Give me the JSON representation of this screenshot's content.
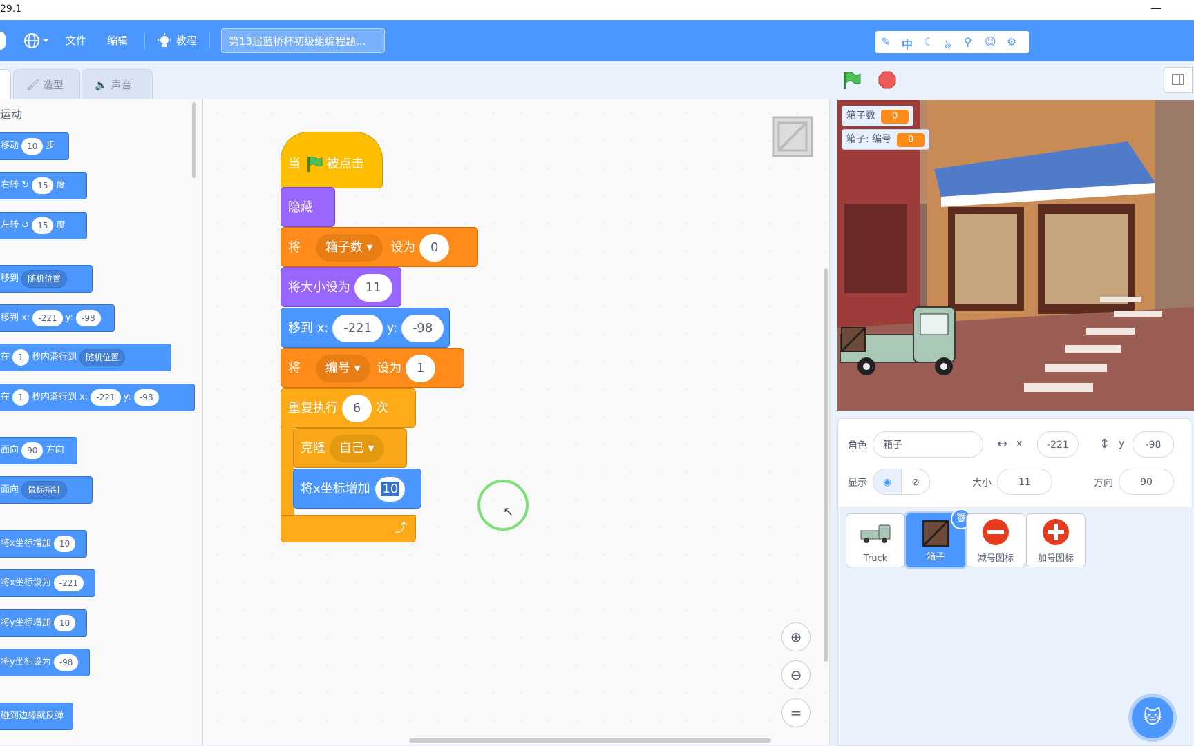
{
  "window": {
    "title": "29.1",
    "min": "—",
    "close": "—"
  },
  "menubar": {
    "file": "文件",
    "edit": "编辑",
    "tutorials": "教程",
    "project_title": "第13届蓝桥杯初级组编程题...",
    "addon_icons": [
      "edit-icon",
      "language-icon",
      "moon-icon",
      "addon-icon",
      "user-icon",
      "emoji-icon",
      "gear-icon"
    ],
    "addon_lang": "中"
  },
  "tabs": {
    "costumes": "造型",
    "sounds": "声音"
  },
  "palette": {
    "category": "运动",
    "blocks": [
      {
        "pre": "移动",
        "v1": "10",
        "post": "步"
      },
      {
        "pre": "右转",
        "v1": "15",
        "post": "度"
      },
      {
        "pre": "左转",
        "v1": "15",
        "post": "度"
      },
      {
        "pre": "移到",
        "d1": "随机位置"
      },
      {
        "pre": "移到 x:",
        "v1": "-221",
        "mid": "y:",
        "v2": "-98"
      },
      {
        "pre": "在",
        "v1": "1",
        "mid": "秒内滑行到",
        "d1": "随机位置"
      },
      {
        "pre": "在",
        "v1": "1",
        "mid": "秒内滑行到 x:",
        "v2": "-221",
        "mid2": "y:",
        "v3": "-98"
      },
      {
        "pre": "面向",
        "v1": "90",
        "post": "方向"
      },
      {
        "pre": "面向",
        "d1": "鼠标指针"
      },
      {
        "pre": "将x坐标增加",
        "v1": "10"
      },
      {
        "pre": "将x坐标设为",
        "v1": "-221"
      },
      {
        "pre": "将y坐标增加",
        "v1": "10"
      },
      {
        "pre": "将y坐标设为",
        "v1": "-98"
      },
      {
        "pre": "碰到边缘就反弹"
      }
    ]
  },
  "script": {
    "hat_when": "当",
    "hat_clicked": "被点击",
    "hide": "隐藏",
    "set_var_label": "将",
    "set_var_name": "箱子数",
    "set_to": "设为",
    "set_var_value": "0",
    "size_label": "将大小设为",
    "size_value": "11",
    "goto_label": "移到 x:",
    "goto_x": "-221",
    "goto_y_label": "y:",
    "goto_y": "-98",
    "set_var2_label": "将",
    "set_var2_name": "编号",
    "set_to2": "设为",
    "set_var2_value": "1",
    "repeat_label": "重复执行",
    "repeat_count": "6",
    "repeat_unit": "次",
    "clone_label": "克隆",
    "clone_target": "自己",
    "change_x_label": "将x坐标增加",
    "change_x_value": "10"
  },
  "stage": {
    "monitors": [
      {
        "label": "箱子数",
        "value": "0"
      },
      {
        "label": "箱子: 编号",
        "value": "0"
      }
    ]
  },
  "sprite_info": {
    "sprite_label": "角色",
    "sprite_name": "箱子",
    "x_label": "x",
    "x_value": "-221",
    "y_label": "y",
    "y_value": "-98",
    "show_label": "显示",
    "size_label": "大小",
    "size_value": "11",
    "direction_label": "方向",
    "direction_value": "90"
  },
  "sprites": [
    {
      "name": "Truck",
      "selected": false
    },
    {
      "name": "箱子",
      "selected": true
    },
    {
      "name": "减号图标",
      "selected": false
    },
    {
      "name": "加号图标",
      "selected": false
    }
  ],
  "colors": {
    "menubar": "#4c97ff",
    "events": "#ffbf00",
    "looks": "#9966ff",
    "variables": "#ff8c1a",
    "motion": "#4c97ff",
    "control": "#ffab19"
  }
}
